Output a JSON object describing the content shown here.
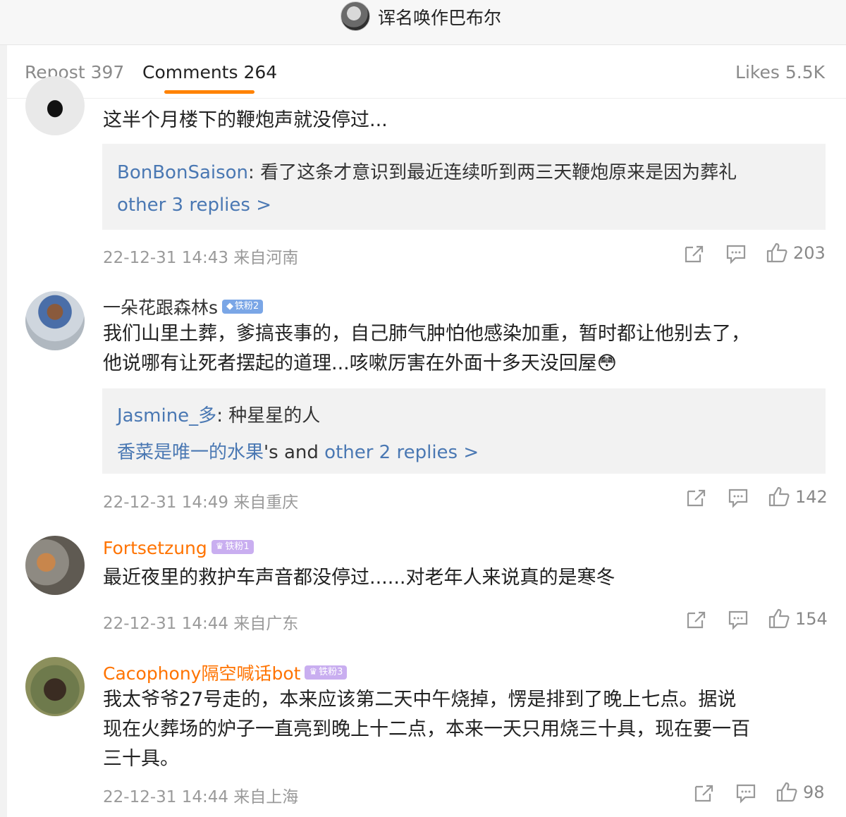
{
  "header": {
    "title": "诨名唤作巴布尔"
  },
  "tabs": {
    "repost": "Repost 397",
    "comments": "Comments 264",
    "likes": "Likes 5.5K"
  },
  "comments": [
    {
      "text": "这半个月楼下的鞭炮声就没停过...",
      "reply": {
        "user": "BonBonSaison",
        "text": ": 看了这条才意识到最近连续听到两三天鞭炮原来是因为葬礼",
        "more": "other 3 replies >"
      },
      "time": "22-12-31 14:43 来自河南",
      "likes": "203"
    },
    {
      "user": "一朵花跟森林s",
      "badge": "铁粉2",
      "text_line1": "我们山里土葬，爹搞丧事的，自己肺气肿怕他感染加重，暂时都让他别去了，",
      "text_line2": "他说哪有让死者摆起的道理...咳嗽厉害在外面十多天没回屋",
      "emoji": "😳",
      "reply": {
        "user": "Jasmine_多",
        "text": ": 种星星的人",
        "user2": "香菜是唯一的水果",
        "mid": "'s and ",
        "more": "other 2 replies >"
      },
      "time": "22-12-31 14:49 来自重庆",
      "likes": "142"
    },
    {
      "user": "Fortsetzung",
      "badge": "铁粉1",
      "text": "最近夜里的救护车声音都没停过......对老年人来说真的是寒冬",
      "time": "22-12-31 14:44 来自广东",
      "likes": "154"
    },
    {
      "user": "Cacophony隔空喊话bot",
      "badge": "铁粉3",
      "text_line1": "我太爷爷27号走的，本来应该第二天中午烧掉，愣是排到了晚上七点。据说",
      "text_line2": "现在火葬场的炉子一直亮到晚上十二点，本来一天只用烧三十具，现在要一百",
      "text_line3": "三十具。",
      "time": "22-12-31 14:44 来自上海",
      "likes": "98"
    }
  ],
  "icons": {
    "share": "share-icon",
    "comment": "comment-icon",
    "like": "thumbs-up-icon",
    "crown": "crown-icon",
    "diamond": "diamond-icon"
  },
  "colors": {
    "accent": "#ff8200",
    "link": "#4a78b3",
    "username_vip": "#ff7300"
  }
}
